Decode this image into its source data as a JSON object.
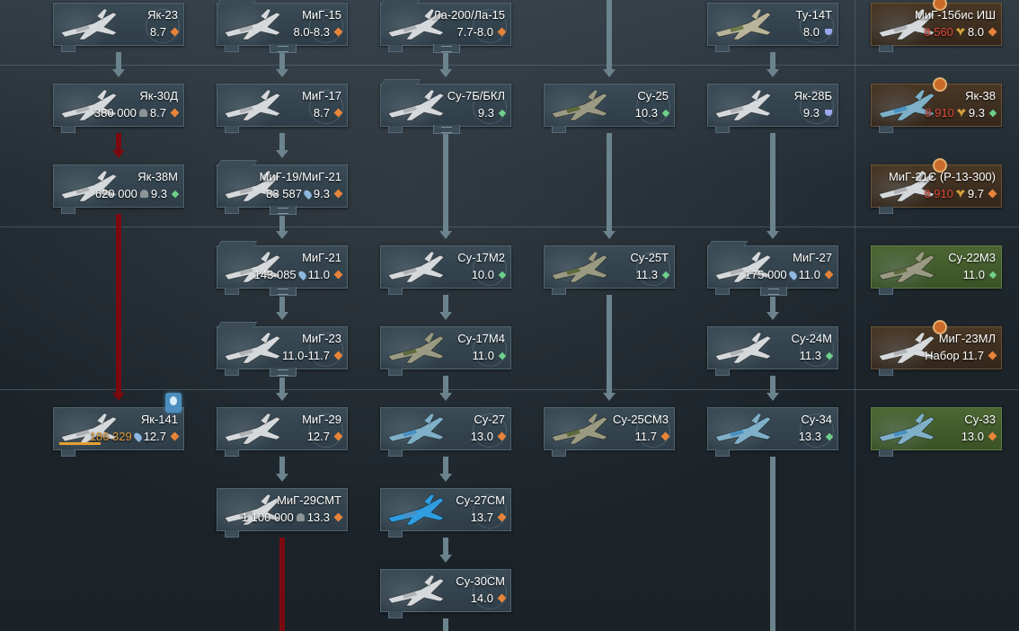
{
  "ranks": [
    {
      "row": 0,
      "vehicles": [
        {
          "col": 0,
          "name": "Як-23",
          "br": "8.7",
          "rank_icon": "orange",
          "type": "tree"
        },
        {
          "col": 1,
          "name": "МиГ-15",
          "br": "8.0-8.3",
          "rank_icon": "orange",
          "type": "group"
        },
        {
          "col": 2,
          "name": "Ла-200/Ла-15",
          "br": "7.7-8.0",
          "rank_icon": "orange",
          "type": "group"
        },
        {
          "col": 4,
          "name": "Ту-14Т",
          "br": "8.0",
          "rank_icon": "blue",
          "type": "tree"
        },
        {
          "col": 5,
          "name": "МиГ-15бис ИШ",
          "cost": "8 560",
          "cost_currency": "golden-eagles",
          "br": "8.0",
          "rank_icon": "orange",
          "type": "premium"
        }
      ]
    },
    {
      "row": 1,
      "vehicles": [
        {
          "col": 0,
          "name": "Як-30Д",
          "cost": "380 000",
          "cost_currency": "silver-lions",
          "br": "8.7",
          "rank_icon": "orange",
          "type": "tree"
        },
        {
          "col": 1,
          "name": "МиГ-17",
          "br": "8.7",
          "rank_icon": "orange",
          "type": "tree"
        },
        {
          "col": 2,
          "name": "Су-7Б/БКЛ",
          "br": "9.3",
          "rank_icon": "green",
          "type": "group"
        },
        {
          "col": 3,
          "name": "Су-25",
          "br": "10.3",
          "rank_icon": "green",
          "type": "tree"
        },
        {
          "col": 4,
          "name": "Як-28Б",
          "br": "9.3",
          "rank_icon": "blue",
          "type": "tree"
        },
        {
          "col": 5,
          "name": "Як-38",
          "cost": "8 910",
          "cost_currency": "golden-eagles",
          "br": "9.3",
          "rank_icon": "green",
          "type": "premium"
        }
      ]
    },
    {
      "row": 2,
      "vehicles": [
        {
          "col": 0,
          "name": "Як-38М",
          "cost": "620 000",
          "cost_currency": "silver-lions",
          "br": "9.3",
          "rank_icon": "green",
          "type": "tree"
        },
        {
          "col": 1,
          "name": "МиГ-19/МиГ-21",
          "cost": "83 587",
          "cost_currency": "research",
          "br": "9.3",
          "rank_icon": "orange",
          "type": "group"
        },
        {
          "col": 5,
          "name": "МиГ-21С (Р-13-300)",
          "cost": "8 910",
          "cost_currency": "golden-eagles",
          "br": "9.7",
          "rank_icon": "orange",
          "type": "premium"
        }
      ]
    },
    {
      "row": 3,
      "vehicles": [
        {
          "col": 1,
          "name": "МиГ-21",
          "cost": "143 085",
          "cost_currency": "research",
          "br": "11.0",
          "rank_icon": "orange",
          "type": "group"
        },
        {
          "col": 2,
          "name": "Су-17М2",
          "br": "10.0",
          "rank_icon": "green",
          "type": "tree"
        },
        {
          "col": 3,
          "name": "Су-25Т",
          "br": "11.3",
          "rank_icon": "green",
          "type": "tree"
        },
        {
          "col": 4,
          "name": "МиГ-27",
          "cost": "175 000",
          "cost_currency": "research",
          "br": "11.0",
          "rank_icon": "orange",
          "type": "group"
        },
        {
          "col": 5,
          "name": "Су-22М3",
          "br": "11.0",
          "rank_icon": "green",
          "type": "squadron"
        }
      ]
    },
    {
      "row": 4,
      "vehicles": [
        {
          "col": 1,
          "name": "МиГ-23",
          "br": "11.0-11.7",
          "rank_icon": "orange",
          "type": "group"
        },
        {
          "col": 2,
          "name": "Су-17М4",
          "br": "11.0",
          "rank_icon": "green",
          "type": "tree"
        },
        {
          "col": 4,
          "name": "Су-24М",
          "br": "11.3",
          "rank_icon": "green",
          "type": "tree"
        },
        {
          "col": 5,
          "name": "МиГ-23МЛ",
          "cost": "Набор",
          "cost_currency": "pack",
          "br": "11.7",
          "rank_icon": "orange",
          "type": "premium"
        }
      ]
    },
    {
      "row": 5,
      "vehicles": [
        {
          "col": 0,
          "name": "Як-141",
          "cost": "186 329",
          "cost_currency": "research-progress",
          "br": "12.7",
          "rank_icon": "orange",
          "type": "tree"
        },
        {
          "col": 1,
          "name": "МиГ-29",
          "br": "12.7",
          "rank_icon": "orange",
          "type": "tree"
        },
        {
          "col": 2,
          "name": "Су-27",
          "br": "13.0",
          "rank_icon": "orange",
          "type": "tree"
        },
        {
          "col": 3,
          "name": "Су-25СМ3",
          "br": "11.7",
          "rank_icon": "orange",
          "type": "tree"
        },
        {
          "col": 4,
          "name": "Су-34",
          "br": "13.3",
          "rank_icon": "green",
          "type": "tree"
        },
        {
          "col": 5,
          "name": "Су-33",
          "br": "13.0",
          "rank_icon": "orange",
          "type": "squadron"
        }
      ]
    },
    {
      "row": 6,
      "vehicles": [
        {
          "col": 1,
          "name": "МиГ-29СМТ",
          "cost": "1 100 000",
          "cost_currency": "silver-lions",
          "br": "13.3",
          "rank_icon": "orange",
          "type": "tree"
        },
        {
          "col": 2,
          "name": "Су-27СМ",
          "br": "13.7",
          "rank_icon": "orange",
          "type": "tree"
        }
      ]
    },
    {
      "row": 7,
      "vehicles": [
        {
          "col": 2,
          "name": "Су-30СМ",
          "br": "14.0",
          "rank_icon": "orange",
          "type": "tree"
        }
      ]
    }
  ],
  "colors": {
    "background": "#1b2329",
    "card": "#34444f",
    "premium_card": "#3e2f21",
    "squadron_card": "#43602d",
    "connector": "#6b838d",
    "researching_connector": "#7a0a10",
    "gold_cost": "#e04a3a",
    "research_cost": "#e09a3a",
    "br_orange": "#e8843a",
    "br_green": "#6fd08a",
    "br_blue": "#9aa6ee"
  }
}
